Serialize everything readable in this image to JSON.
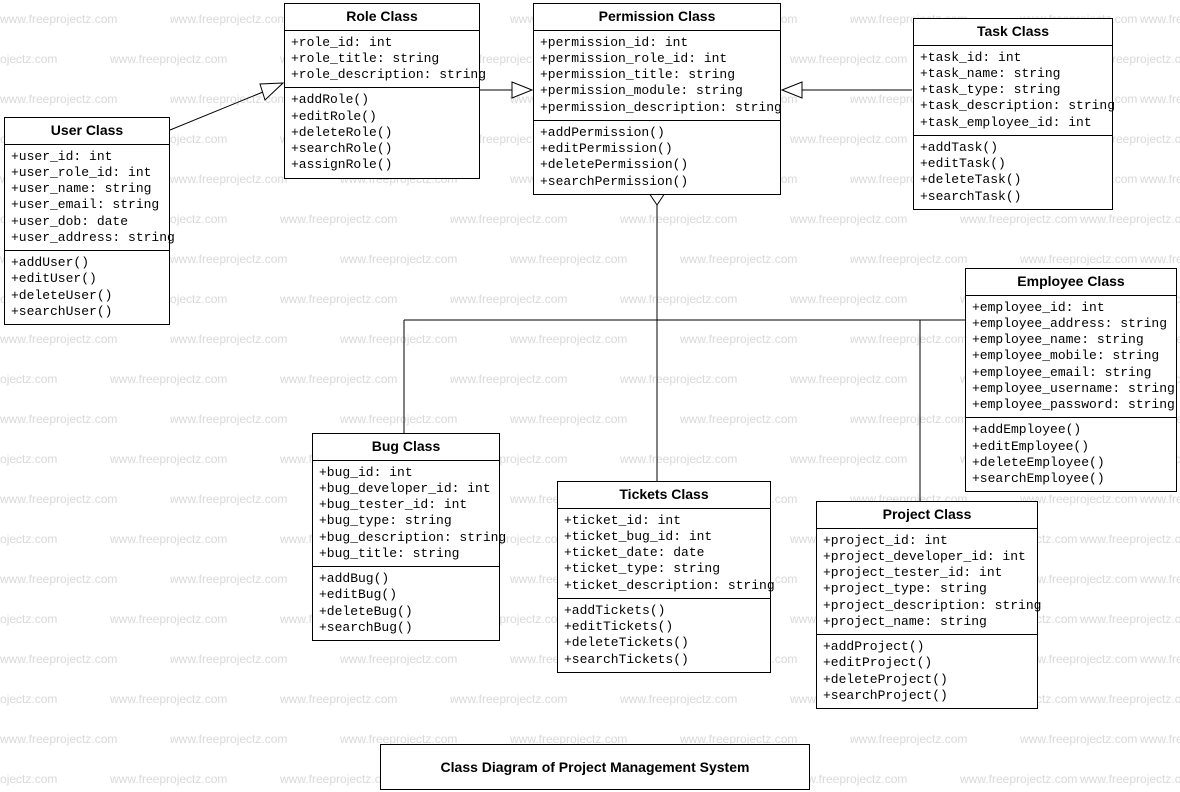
{
  "watermark_text": "www.freeprojectz.com",
  "diagram_title": "Class Diagram of Project Management System",
  "classes": {
    "user": {
      "title": "User Class",
      "attrs": [
        "+user_id: int",
        "+user_role_id: int",
        "+user_name: string",
        "+user_email: string",
        "+user_dob: date",
        "+user_address: string"
      ],
      "ops": [
        "+addUser()",
        "+editUser()",
        "+deleteUser()",
        "+searchUser()"
      ]
    },
    "role": {
      "title": "Role Class",
      "attrs": [
        "+role_id: int",
        "+role_title: string",
        "+role_description: string"
      ],
      "ops": [
        "+addRole()",
        "+editRole()",
        "+deleteRole()",
        "+searchRole()",
        "+assignRole()"
      ]
    },
    "permission": {
      "title": "Permission Class",
      "attrs": [
        "+permission_id: int",
        "+permission_role_id: int",
        "+permission_title: string",
        "+permission_module: string",
        "+permission_description: string"
      ],
      "ops": [
        "+addPermission()",
        "+editPermission()",
        "+deletePermission()",
        "+searchPermission()"
      ]
    },
    "task": {
      "title": "Task Class",
      "attrs": [
        "+task_id: int",
        "+task_name: string",
        "+task_type: string",
        "+task_description: string",
        "+task_employee_id: int"
      ],
      "ops": [
        "+addTask()",
        "+editTask()",
        "+deleteTask()",
        "+searchTask()"
      ]
    },
    "employee": {
      "title": "Employee Class",
      "attrs": [
        "+employee_id: int",
        "+employee_address: string",
        "+employee_name: string",
        "+employee_mobile: string",
        "+employee_email: string",
        "+employee_username: string",
        "+employee_password: string"
      ],
      "ops": [
        "+addEmployee()",
        "+editEmployee()",
        "+deleteEmployee()",
        "+searchEmployee()"
      ]
    },
    "bug": {
      "title": "Bug Class",
      "attrs": [
        "+bug_id: int",
        "+bug_developer_id: int",
        "+bug_tester_id: int",
        "+bug_type: string",
        "+bug_description: string",
        "+bug_title: string"
      ],
      "ops": [
        "+addBug()",
        "+editBug()",
        "+deleteBug()",
        "+searchBug()"
      ]
    },
    "tickets": {
      "title": "Tickets Class",
      "attrs": [
        "+ticket_id: int",
        "+ticket_bug_id: int",
        "+ticket_date: date",
        "+ticket_type: string",
        "+ticket_description: string"
      ],
      "ops": [
        "+addTickets()",
        "+editTickets()",
        "+deleteTickets()",
        "+searchTickets()"
      ]
    },
    "project": {
      "title": "Project Class",
      "attrs": [
        "+project_id: int",
        "+project_developer_id: int",
        "+project_tester_id: int",
        "+project_type: string",
        "+project_description: string",
        "+project_name: string"
      ],
      "ops": [
        "+addProject()",
        "+editProject()",
        "+deleteProject()",
        "+searchProject()"
      ]
    }
  }
}
